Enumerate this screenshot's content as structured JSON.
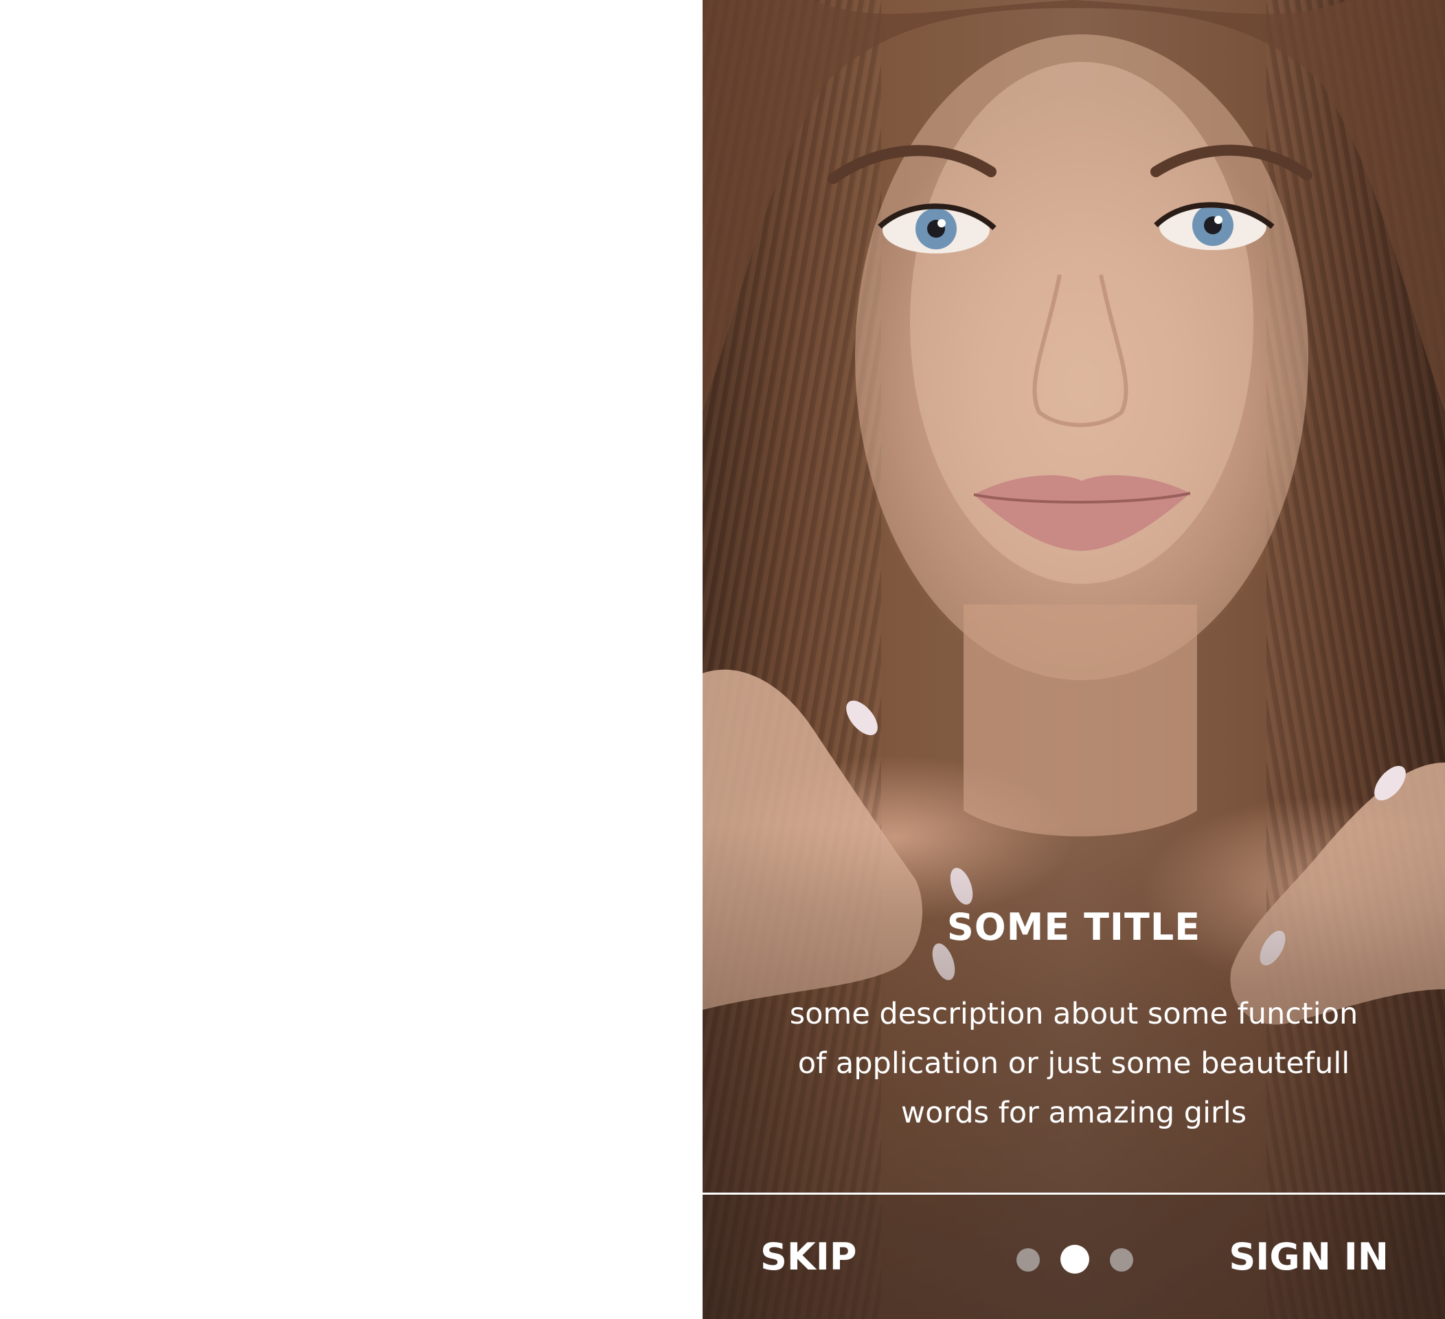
{
  "onboarding": {
    "title": "SOME TITLE",
    "description": "some description about some function of application or just some beautefull words for amazing girls",
    "skip_label": "SKIP",
    "signin_label": "SIGN IN",
    "pager": {
      "total_pages": 3,
      "active_page": 2
    },
    "colors": {
      "text": "#ffffff",
      "divider": "#ffffff",
      "dot_active": "#ffffff",
      "dot_inactive": "#c8c8c8"
    },
    "background_image": "portrait-woman-long-brown-hair"
  }
}
